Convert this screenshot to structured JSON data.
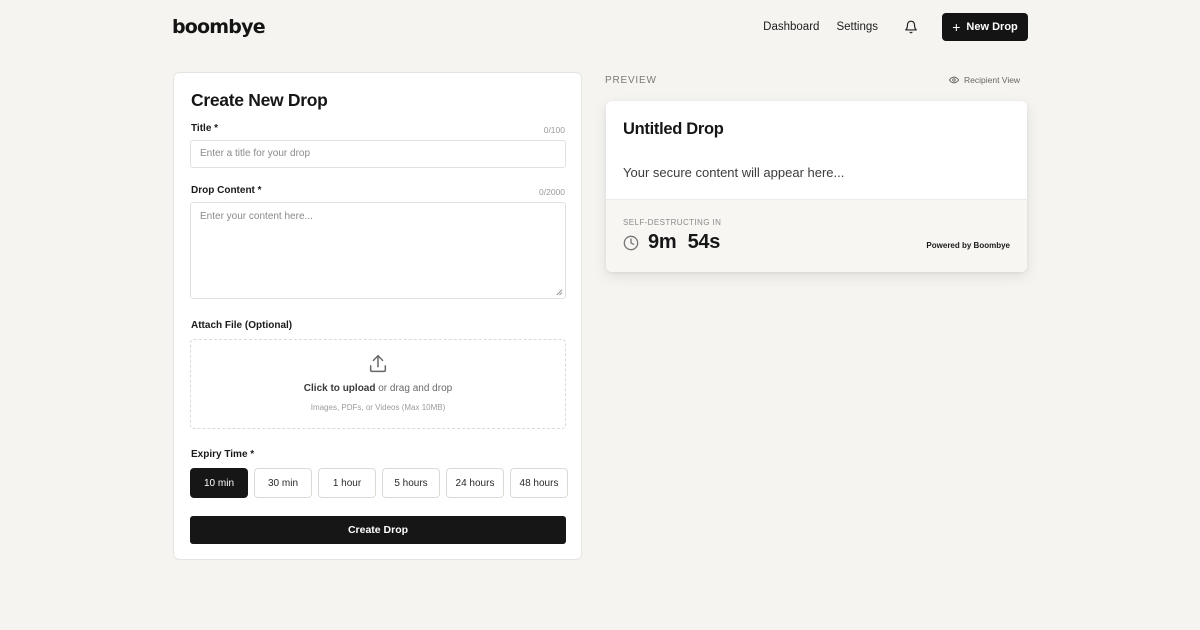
{
  "header": {
    "logo": "boombye",
    "nav": [
      "Dashboard",
      "Settings"
    ],
    "new_drop_label": "New Drop",
    "icons": {
      "bell": "bell-icon",
      "plus": "plus-icon"
    }
  },
  "form": {
    "title": "Create New Drop",
    "title_field": {
      "label": "Title *",
      "counter": "0/100",
      "placeholder": "Enter a title for your drop"
    },
    "content_field": {
      "label": "Drop Content *",
      "counter": "0/2000",
      "placeholder": "Enter your content here..."
    },
    "attach": {
      "label": "Attach File (Optional)",
      "cta": "Click to upload",
      "cta_rest": " or drag and drop",
      "hint": "Images, PDFs, or Videos (Max 10MB)"
    },
    "expiry": {
      "label": "Expiry Time *",
      "options": [
        "10 min",
        "30 min",
        "1 hour",
        "5 hours",
        "24 hours",
        "48 hours"
      ],
      "selected": "10 min"
    },
    "submit_label": "Create Drop"
  },
  "preview": {
    "section_label": "PREVIEW",
    "recipient_view_label": "Recipient View",
    "card_title": "Untitled Drop",
    "card_body": "Your secure content will appear here...",
    "countdown_label": "SELF-DESTRUCTING IN",
    "countdown": "9m 54s",
    "powered_by": "Powered by Boombye"
  },
  "colors": {
    "background": "#f5f4f0",
    "accent": "#161616",
    "card": "#ffffff"
  }
}
